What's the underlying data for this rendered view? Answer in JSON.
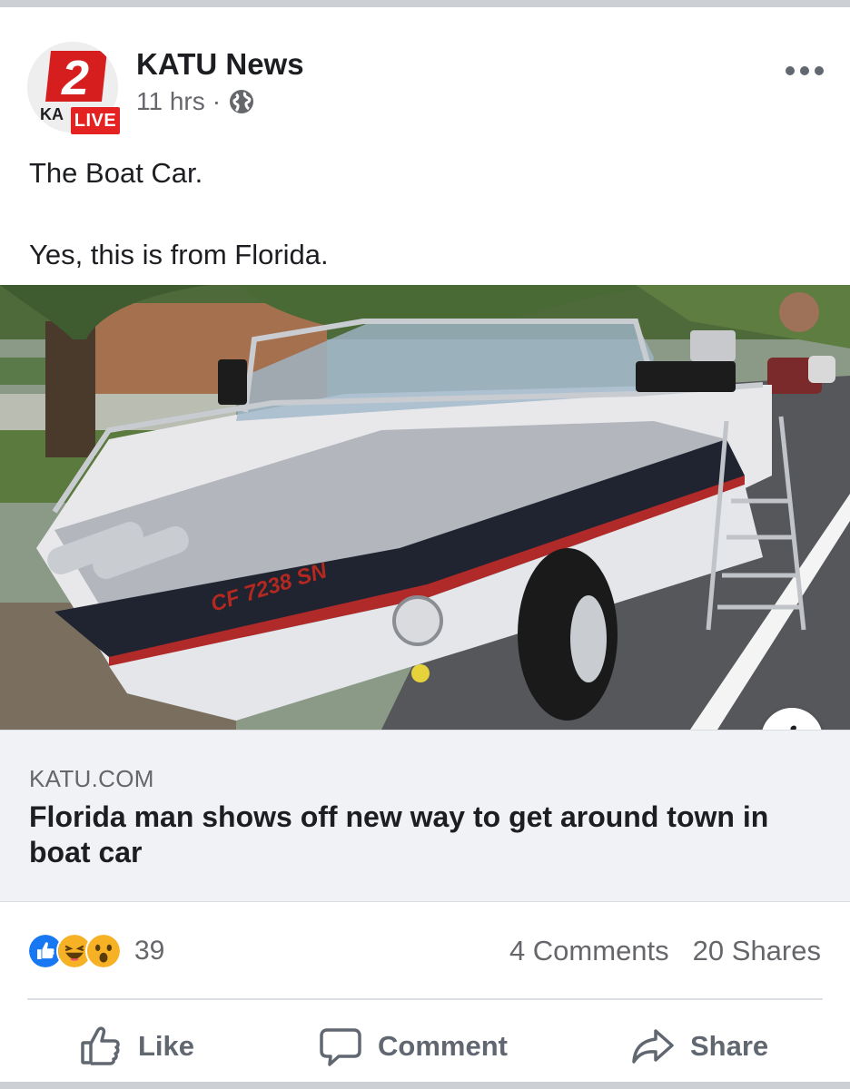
{
  "post": {
    "page_name": "KATU News",
    "avatar": {
      "channel_number": "2",
      "letters": "KA",
      "live_badge": "LIVE"
    },
    "time": "11 hrs",
    "separator": "·",
    "privacy_icon": "globe-icon",
    "menu_icon": "more-horizontal-icon",
    "text_line_1": "The Boat Car.",
    "text_line_2": "Yes, this is from Florida."
  },
  "link_preview": {
    "image_description_icon": "info-icon",
    "info_glyph": "i",
    "domain": "KATU.COM",
    "title": "Florida man shows off new way to get around town in boat car",
    "plate_text": "CF 7238 SN"
  },
  "engagement": {
    "reaction_icons": [
      "like-reaction-icon",
      "haha-reaction-icon",
      "wow-reaction-icon"
    ],
    "reaction_count": "39",
    "comments": "4 Comments",
    "shares": "20 Shares"
  },
  "actions": {
    "like": "Like",
    "comment": "Comment",
    "share": "Share"
  },
  "colors": {
    "facebook_blue": "#1877f2",
    "text_secondary": "#65676b",
    "live_red": "#e42222",
    "link_bg": "#f0f2f5"
  }
}
